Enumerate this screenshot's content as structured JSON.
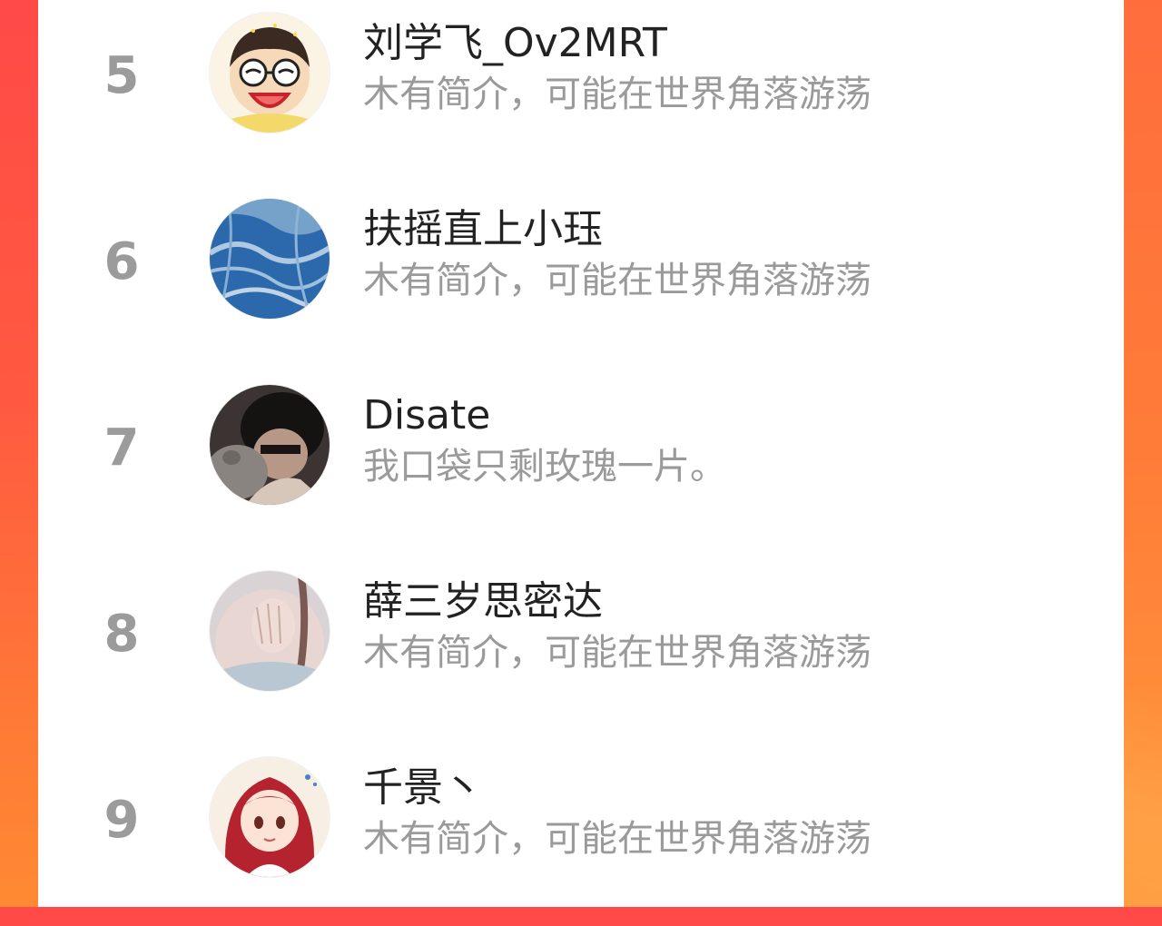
{
  "ranking": {
    "items": [
      {
        "rank": "5",
        "name": "刘学飞_Ov2MRT",
        "bio": "木有简介，可能在世界角落游荡",
        "avatar": "cartoon-boy-glasses-avatar"
      },
      {
        "rank": "6",
        "name": "扶摇直上小珏",
        "bio": "木有简介，可能在世界角落游荡",
        "avatar": "aerial-blue-river-avatar"
      },
      {
        "rank": "7",
        "name": "Disate",
        "bio": "我口袋只剩玫瑰一片。",
        "avatar": "person-with-cat-avatar"
      },
      {
        "rank": "8",
        "name": "薛三岁思密达",
        "bio": "木有简介，可能在世界角落游荡",
        "avatar": "hand-portrait-avatar"
      },
      {
        "rank": "9",
        "name": "千景丶",
        "bio": "木有简介，可能在世界角落游荡",
        "avatar": "anime-girl-red-hair-avatar"
      }
    ]
  },
  "colors": {
    "background_left": "#ff4a47",
    "background_right": "#ff8a33",
    "card": "#ffffff",
    "rank_text": "#9b9b9b",
    "name_text": "#222222",
    "bio_text": "#9a9a9a"
  }
}
